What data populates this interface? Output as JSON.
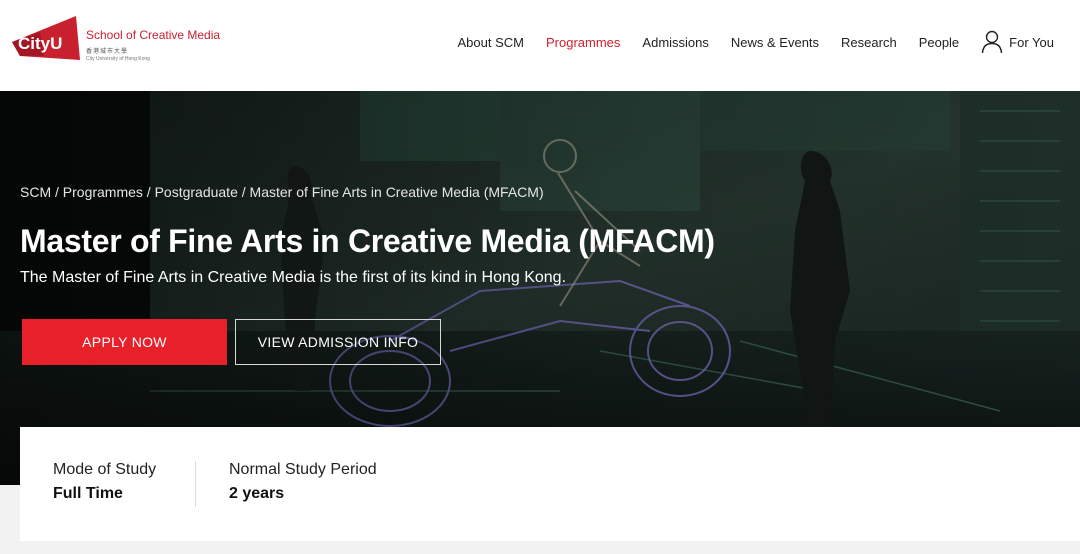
{
  "logo": {
    "mark_text": "CityU",
    "school": "School of Creative Media",
    "chinese": "香港城市大學",
    "english": "City University of Hong Kong",
    "brand_color": "#c8202f"
  },
  "nav": {
    "items": [
      "About SCM",
      "Programmes",
      "Admissions",
      "News & Events",
      "Research",
      "People"
    ],
    "active_index": 1,
    "for_you": "For You",
    "user_icon": "user-icon"
  },
  "hero": {
    "breadcrumb": "SCM / Programmes / Postgraduate / Master of Fine Arts in Creative Media (MFACM)",
    "title": "Master of Fine Arts in Creative Media (MFACM)",
    "subtitle": "The Master of Fine Arts in Creative Media is the first of its kind in Hong Kong.",
    "apply_label": "APPLY NOW",
    "view_label": "VIEW ADMISSION INFO",
    "accent_color": "#e8202a"
  },
  "info": {
    "mode_label": "Mode of Study",
    "mode_value": "Full Time",
    "period_label": "Normal Study Period",
    "period_value": "2 years"
  }
}
